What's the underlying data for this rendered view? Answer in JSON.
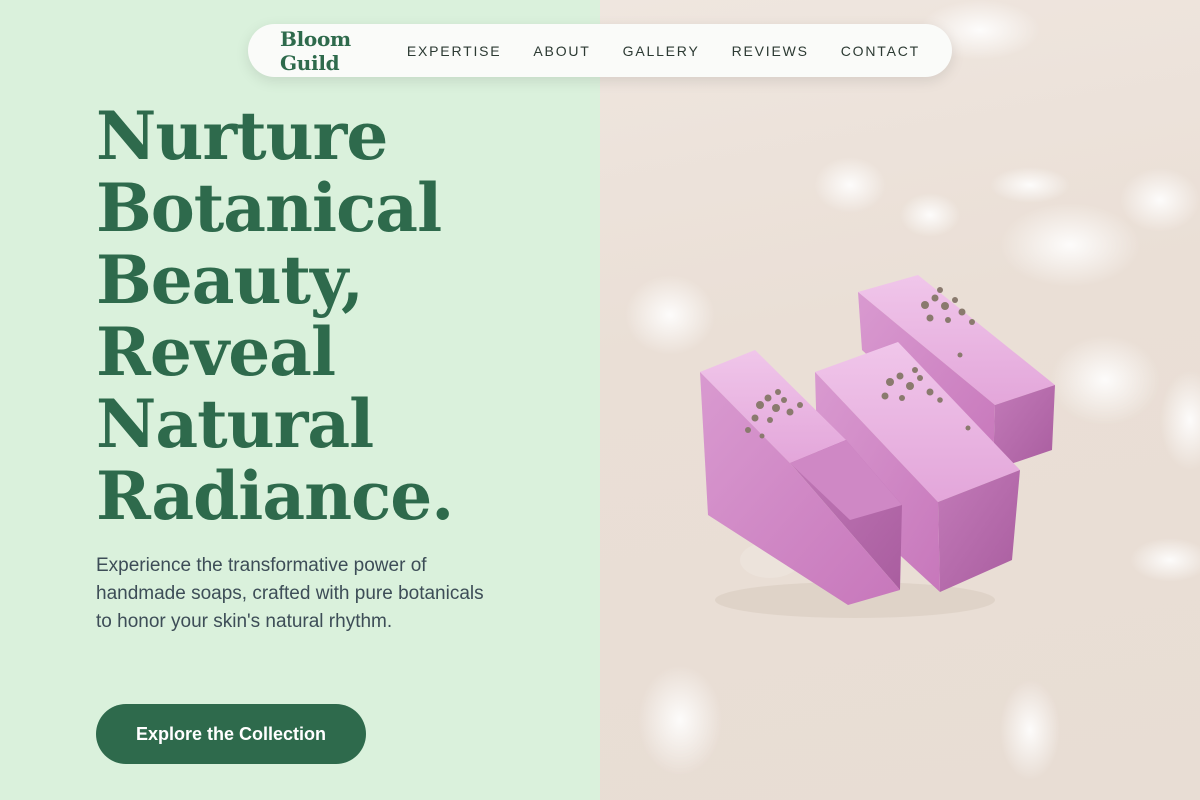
{
  "nav": {
    "brand": "Bloom Guild",
    "links": [
      {
        "label": "EXPERTISE"
      },
      {
        "label": "ABOUT"
      },
      {
        "label": "GALLERY"
      },
      {
        "label": "REVIEWS"
      },
      {
        "label": "CONTACT"
      }
    ]
  },
  "hero": {
    "title_lines": [
      "Nurture",
      "Botanical",
      "Beauty,",
      "Reveal",
      "Natural",
      "Radiance."
    ],
    "subtitle": "Experience the transformative power of handmade soaps, crafted with pure botanicals to honor your skin's natural rhythm.",
    "cta_label": "Explore the Collection"
  },
  "colors": {
    "accent": "#2e6a4c",
    "left_background": "#daf1dc",
    "body_text": "#3d4d57",
    "soap_pink": "#d98fce",
    "lavender_buds": "#8a7a6e"
  },
  "image": {
    "subject": "lavender-soap-bars-photo"
  }
}
